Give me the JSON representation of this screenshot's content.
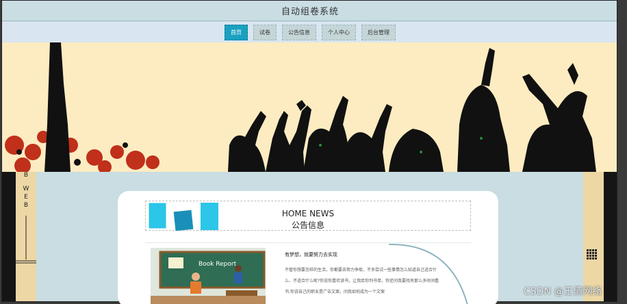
{
  "app": {
    "title": "自动组卷系统"
  },
  "nav": {
    "items": [
      {
        "label": "首页",
        "active": true
      },
      {
        "label": "试卷",
        "active": false
      },
      {
        "label": "公告信息",
        "active": false
      },
      {
        "label": "个人中心",
        "active": false
      },
      {
        "label": "后台管理",
        "active": false
      }
    ]
  },
  "sidebar": {
    "letters": [
      "B",
      "W",
      "E",
      "B"
    ]
  },
  "news": {
    "heading_en": "HOME NEWS",
    "heading_cn": "公告信息",
    "item": {
      "image_text": "Book Report",
      "title": "有梦想，就要努力去实现",
      "excerpt": "不管你想要怎样的生活，你都要去努力争取，不多尝试一些事情怎么知道自己适合什么、不适合什么呢?你说你喜欢读书，让我给你列书单，你还问我要找有那么多时间看书;你说自己的职业是广告文案，问我如何成为一个文案"
    }
  },
  "icons": [
    "grid-icon"
  ],
  "colors": {
    "active_nav": "#1aa0c0",
    "banner_bg": "#fdecc1",
    "page_bg": "#c9dde3",
    "panel": "#ecd7a5"
  },
  "watermark": "CSDN @王倩网络"
}
